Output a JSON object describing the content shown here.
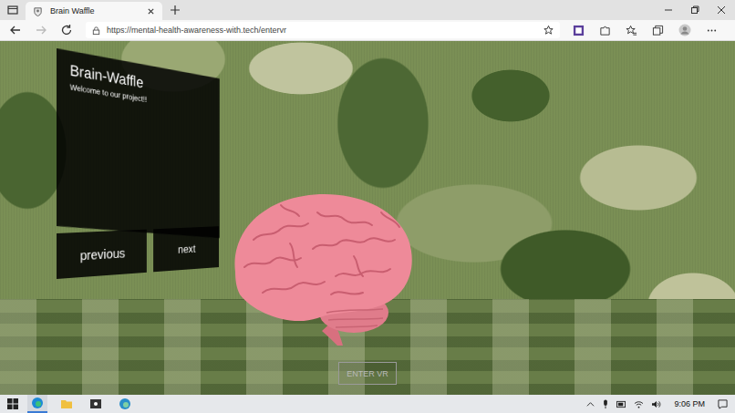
{
  "window": {
    "title": "Brain Waffle"
  },
  "tabs": [
    {
      "label": "Brain Waffle",
      "selected": true
    }
  ],
  "address_bar": {
    "url": "https://mental-health-awareness-with.tech/entervr"
  },
  "scene": {
    "panel": {
      "title": "Brain-Waffle",
      "subtitle": "Welcome to our project!!"
    },
    "buttons": [
      {
        "label": "previous"
      },
      {
        "label": "next"
      }
    ],
    "enter_vr": "ENTER VR"
  },
  "taskbar": {
    "time": "9:06 PM"
  }
}
